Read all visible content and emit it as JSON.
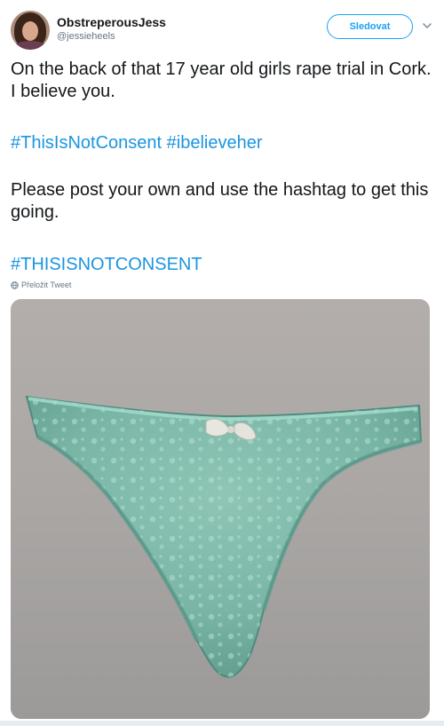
{
  "user": {
    "display_name": "ObstreperousJess",
    "handle": "@jessieheels"
  },
  "follow_button": {
    "label": "Sledovat"
  },
  "tweet": {
    "text_1": "On the back of that 17 year old girls rape trial in Cork. I believe you.",
    "hashtags_1": "#ThisIsNotConsent #ibelieveher",
    "text_2": "Please post your own and use the hashtag to get this going.",
    "hashtag_2": "#THISISNOTCONSENT"
  },
  "translate": {
    "label": "Přeložit Tweet"
  },
  "icons": {
    "caret": "chevron-down-icon",
    "globe": "globe-icon"
  },
  "colors": {
    "link": "#1b95e0",
    "button": "#1da1f2",
    "text": "#14171a",
    "secondary": "#657786"
  }
}
